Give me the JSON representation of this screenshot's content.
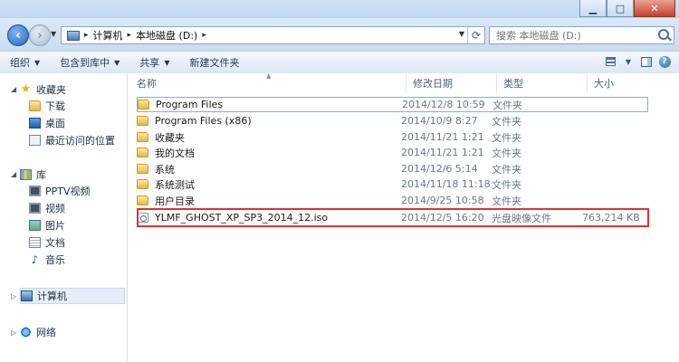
{
  "address": {
    "crumbs": [
      "计算机",
      "本地磁盘 (D:)"
    ]
  },
  "search": {
    "placeholder": "搜索 本地磁盘 (D:)"
  },
  "toolbar": {
    "organize": "组织",
    "include_in_library": "包含到库中",
    "share": "共享",
    "new_folder": "新建文件夹"
  },
  "nav": {
    "favorites": "收藏夹",
    "favorites_items": [
      "下载",
      "桌面",
      "最近访问的位置"
    ],
    "libraries": "库",
    "library_items": [
      "PPTV视频",
      "视频",
      "图片",
      "文档",
      "音乐"
    ],
    "computer": "计算机",
    "network": "网络"
  },
  "columns": {
    "name": "名称",
    "modified": "修改日期",
    "type": "类型",
    "size": "大小"
  },
  "files": [
    {
      "name": "Program Files",
      "date": "2014/12/8 10:59",
      "type": "文件夹",
      "size": ""
    },
    {
      "name": "Program Files (x86)",
      "date": "2014/10/9 8:27",
      "type": "文件夹",
      "size": ""
    },
    {
      "name": "收藏夹",
      "date": "2014/11/21 1:21",
      "type": "文件夹",
      "size": ""
    },
    {
      "name": "我的文档",
      "date": "2014/11/21 1:21",
      "type": "文件夹",
      "size": ""
    },
    {
      "name": "系统",
      "date": "2014/12/6 5:14",
      "type": "文件夹",
      "size": ""
    },
    {
      "name": "系统测试",
      "date": "2014/11/18 11:18",
      "type": "文件夹",
      "size": ""
    },
    {
      "name": "用户目录",
      "date": "2014/9/25 10:58",
      "type": "文件夹",
      "size": ""
    },
    {
      "name": "YLMF_GHOST_XP_SP3_2014_12.iso",
      "date": "2014/12/5 16:20",
      "type": "光盘映像文件",
      "size": "763,214 KB"
    }
  ],
  "colors": {
    "highlight": "#e03131",
    "accent": "#1e395b"
  }
}
